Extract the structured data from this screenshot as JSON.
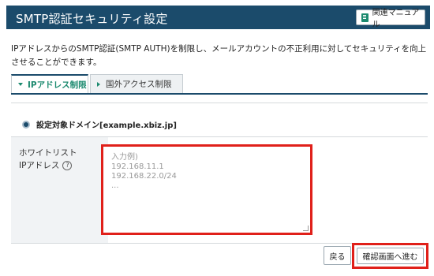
{
  "header": {
    "title": "SMTP認証セキュリティ設定",
    "manual_button_label": "関連マニュアル",
    "manual_icon": "book-icon"
  },
  "description": "IPアドレスからのSMTP認証(SMTP AUTH)を制限し、メールアカウントの不正利用に対してセキュリティを向上させることができます。",
  "tabs": [
    {
      "label": "IPアドレス制限",
      "active": true
    },
    {
      "label": "国外アクセス制限",
      "active": false
    }
  ],
  "domain": {
    "label": "設定対象ドメイン[example.xbiz.jp]"
  },
  "whitelist": {
    "label_line1": "ホワイトリスト",
    "label_line2": "IPアドレス",
    "help_icon": "?",
    "placeholder": "入力例)\n192.168.11.1\n192.168.22.0/24\n..."
  },
  "actions": {
    "back_label": "戻る",
    "confirm_label": "確認画面へ進む"
  },
  "colors": {
    "header_bg": "#1b4b6b",
    "accent": "#1c8a6f",
    "highlight": "#e0201a"
  }
}
